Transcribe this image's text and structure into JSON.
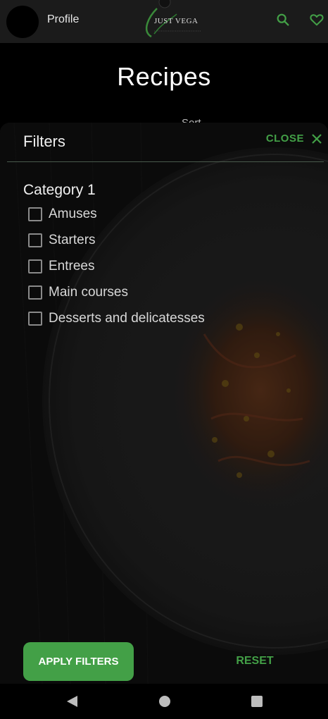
{
  "header": {
    "profile_label": "Profile",
    "logo_text": "JUST VEGA",
    "icons": [
      "search-icon",
      "heart-icon"
    ]
  },
  "page": {
    "title": "Recipes",
    "sort_peek": "Sort"
  },
  "filters": {
    "title": "Filters",
    "close_label": "CLOSE",
    "category_title": "Category 1",
    "options": [
      {
        "label": "Amuses",
        "checked": false
      },
      {
        "label": "Starters",
        "checked": false
      },
      {
        "label": "Entrees",
        "checked": false
      },
      {
        "label": "Main courses",
        "checked": false
      },
      {
        "label": "Desserts and delicatesses",
        "checked": false
      }
    ],
    "apply_label": "APPLY FILTERS",
    "reset_label": "RESET"
  },
  "colors": {
    "accent": "#43a047",
    "topbar": "#1b1b1b",
    "sheet": "#141414"
  },
  "navbar": {
    "icons": [
      "back-icon",
      "home-icon",
      "recents-icon"
    ]
  }
}
